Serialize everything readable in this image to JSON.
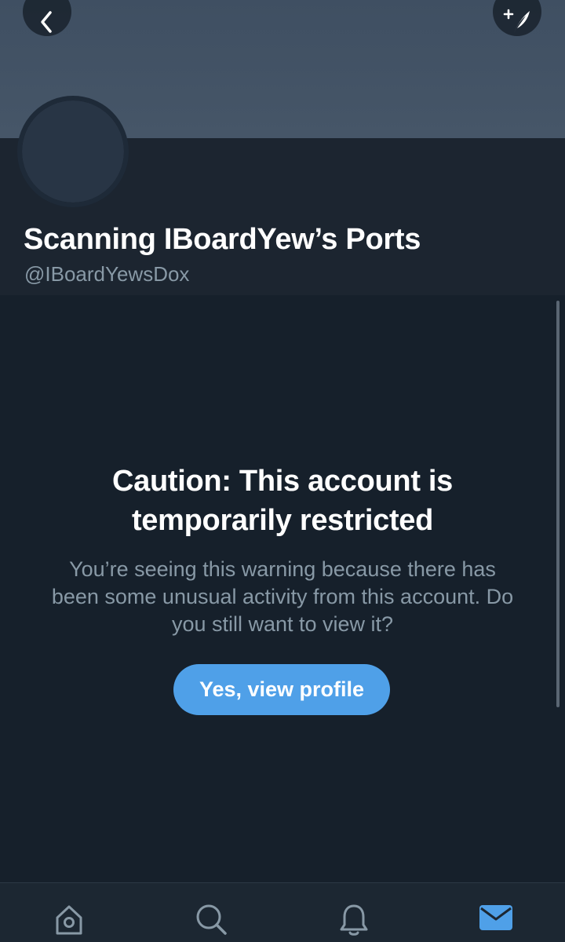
{
  "header": {
    "back_icon": "chevron-left-icon",
    "compose_icon": "compose-feather-icon"
  },
  "profile": {
    "display_name": "Scanning IBoardYew’s Ports",
    "handle": "@IBoardYewsDox"
  },
  "warning": {
    "title": "Caution: This account is temporarily restricted",
    "body": "You’re seeing this warning because there has been some unusual activity from this account. Do you still want to view it?",
    "button_label": "Yes, view profile"
  },
  "tabbar": {
    "tabs": [
      {
        "name": "home",
        "icon": "home-icon",
        "active": false
      },
      {
        "name": "search",
        "icon": "search-icon",
        "active": false
      },
      {
        "name": "notifications",
        "icon": "bell-icon",
        "active": false
      },
      {
        "name": "messages",
        "icon": "mail-icon",
        "active": true
      }
    ]
  },
  "colors": {
    "background": "#16202b",
    "header_panel": "#1c2530",
    "banner": "#465668",
    "accent": "#4fa0e8",
    "secondary_text": "#8899a6",
    "inactive_icon": "#8899a6"
  }
}
